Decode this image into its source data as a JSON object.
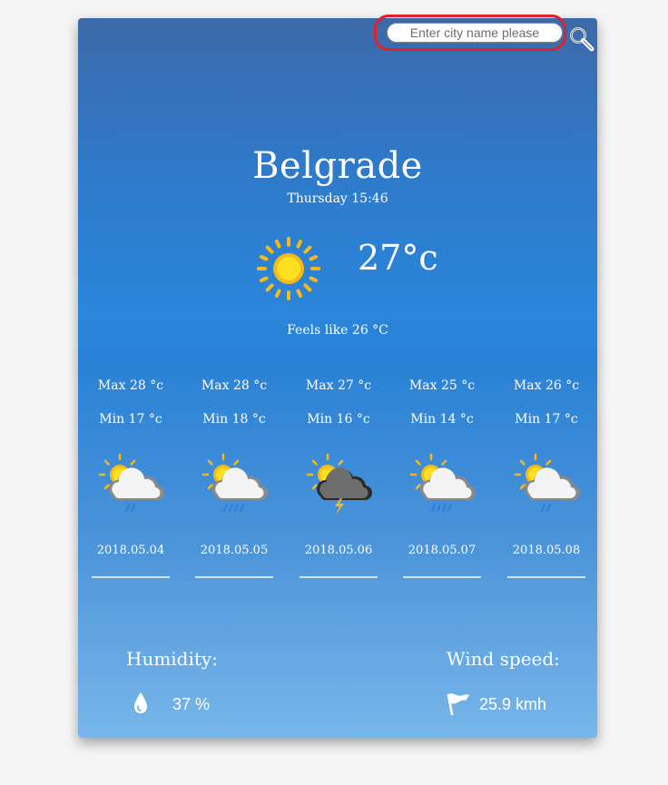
{
  "search": {
    "placeholder": "Enter city name please",
    "icon": "search-icon"
  },
  "current": {
    "city": "Belgrade",
    "datetime": "Thursday 15:46",
    "temperature": "27°c",
    "feels_like": "Feels like 26 °C",
    "icon": "sun-icon"
  },
  "forecast": [
    {
      "max": "Max 28 °c",
      "min": "Min 17 °c",
      "date": "2018.05.04",
      "icon": "sun-cloud-light-rain-icon"
    },
    {
      "max": "Max 28 °c",
      "min": "Min 18 °c",
      "date": "2018.05.05",
      "icon": "sun-cloud-rain-icon"
    },
    {
      "max": "Max 27 °c",
      "min": "Min 16 °c",
      "date": "2018.05.06",
      "icon": "sun-cloud-thunder-icon"
    },
    {
      "max": "Max 25 °c",
      "min": "Min 14 °c",
      "date": "2018.05.07",
      "icon": "sun-cloud-rain-icon"
    },
    {
      "max": "Max 26 °c",
      "min": "Min 17 °c",
      "date": "2018.05.08",
      "icon": "sun-cloud-light-rain-icon"
    }
  ],
  "humidity": {
    "label": "Humidity:",
    "value": "37 %",
    "icon": "water-drop-icon"
  },
  "wind": {
    "label": "Wind speed:",
    "value": "25.9 kmh",
    "icon": "wind-flag-icon"
  },
  "colors": {
    "accent_red": "#e0202a",
    "card_top": "#3d6aa8",
    "card_bottom": "#78b6ea",
    "sun_yellow": "#f7c21a"
  }
}
